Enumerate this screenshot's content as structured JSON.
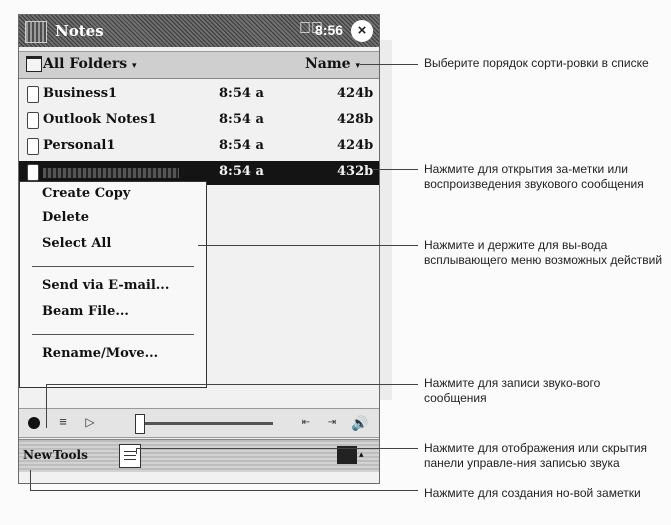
{
  "screen": {
    "app_title": "Notes",
    "volume_icon": "speaker-icon",
    "time": "8:56",
    "close_label": "×",
    "folder_label": "All Folders",
    "sort_label": "Name",
    "caret": "▾"
  },
  "notes": [
    {
      "name": "Business1",
      "time": "8:54 a",
      "size": "424b"
    },
    {
      "name": "Outlook Notes1",
      "time": "8:54 a",
      "size": "428b"
    },
    {
      "name": "Personal1",
      "time": "8:54 a",
      "size": "424b"
    },
    {
      "name": "",
      "time": "8:54 a",
      "size": "432b",
      "selected": true
    }
  ],
  "context_menu": {
    "create_copy": "Create Copy",
    "delete": "Delete",
    "select_all": "Select All",
    "send_email": "Send via E-mail...",
    "beam_file": "Beam File...",
    "rename_move": "Rename/Move..."
  },
  "recording_toolbar": {
    "record_icon": "record-icon",
    "list_icon": "≡",
    "play_icon": "▷",
    "rewind_icon": "⇤",
    "fastforward_icon": "⇥",
    "speaker_icon": "🔊"
  },
  "command_bar": {
    "new_label": "New",
    "tools_label": "Tools",
    "recording_toggle_icon": "recording-toolbar-icon",
    "keyboard_icon": "keyboard-icon",
    "caret": "▴"
  },
  "callouts": {
    "sort_order": "Выберите порядок сорти-ровки в списке",
    "open_note": "Нажмите для открытия за-метки или воспроизведения звукового сообщения",
    "hold_menu": "Нажмите и держите для вы-вода всплывающего меню возможных действий",
    "record": "Нажмите для записи звуко-вого сообщения",
    "toggle_panel": "Нажмите для отображения или скрытия панели управле-ния записью звука",
    "new_note": "Нажмите для создания но-вой заметки"
  }
}
